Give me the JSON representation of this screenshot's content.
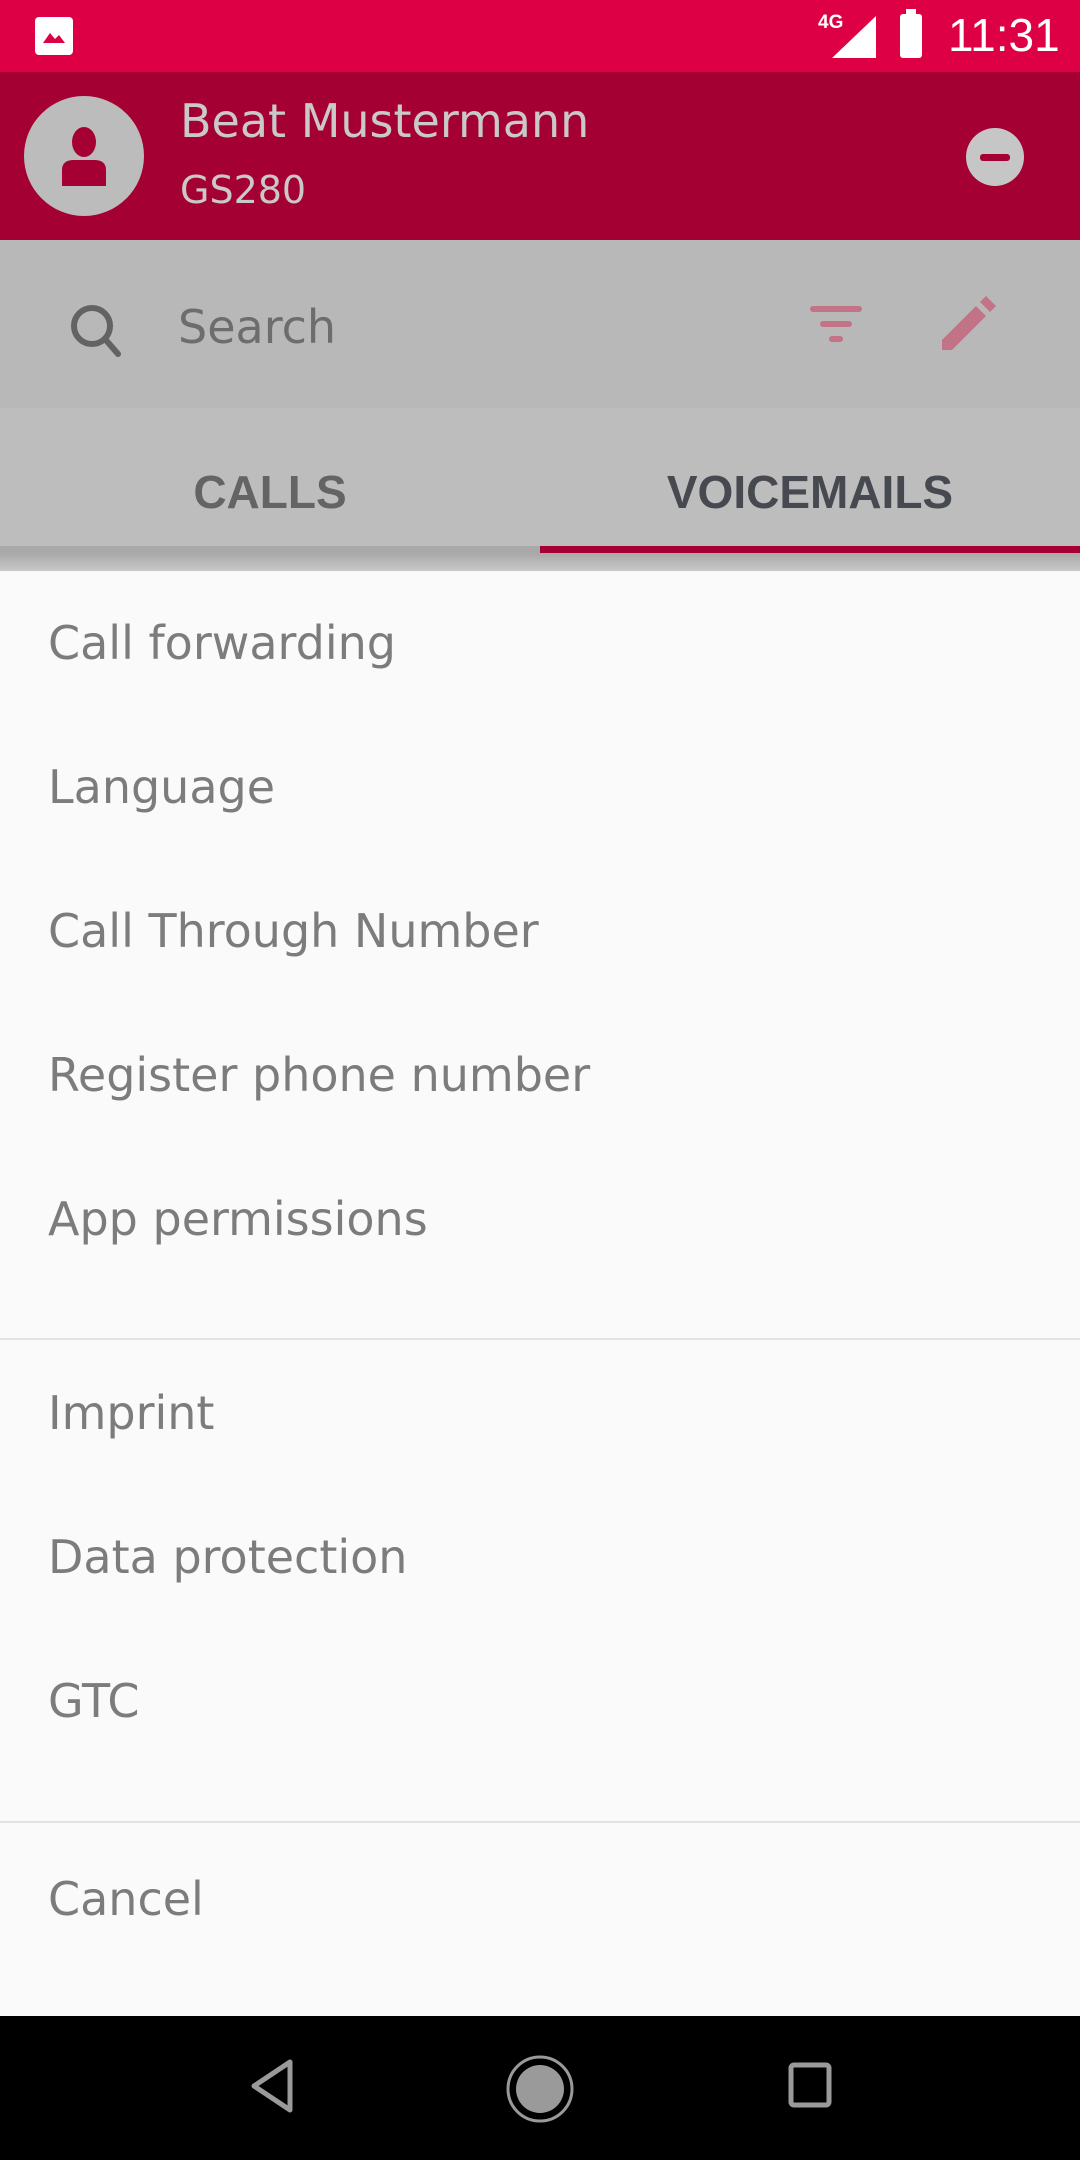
{
  "status_bar": {
    "network": "4G",
    "time": "11:31",
    "icons": [
      "gallery-notification-icon",
      "signal-icon",
      "battery-icon"
    ]
  },
  "header": {
    "user_name": "Beat Mustermann",
    "device": "GS280",
    "avatar_icon": "person-icon",
    "action_icon": "remove-circle-icon"
  },
  "search": {
    "placeholder": "Search",
    "icons": [
      "search-icon",
      "filter-icon",
      "edit-icon"
    ]
  },
  "tabs": [
    {
      "label": "CALLS",
      "selected": false
    },
    {
      "label": "VOICEMAILS",
      "selected": true
    }
  ],
  "menu": {
    "group1": [
      "Call forwarding",
      "Language",
      "Call Through Number",
      "Register phone number",
      "App permissions"
    ],
    "group2": [
      "Imprint",
      "Data protection",
      "GTC"
    ],
    "cancel": "Cancel"
  },
  "nav_bar": {
    "icons": [
      "back-icon",
      "home-icon",
      "recents-icon"
    ]
  },
  "colors": {
    "status_bar": "#dd0044",
    "brand": "#a50033",
    "sheet_bg": "#fafafa",
    "item_text": "#7c7c7c"
  }
}
